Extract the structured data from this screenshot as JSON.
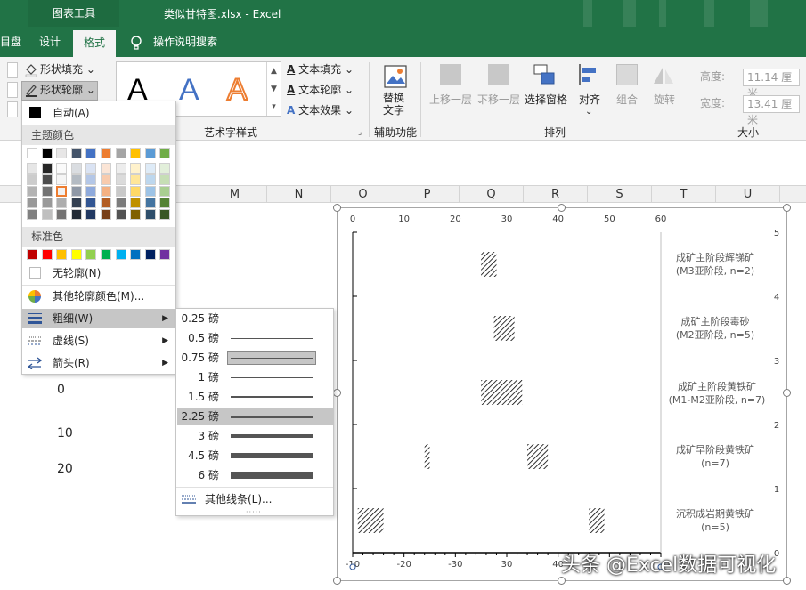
{
  "window": {
    "context_group": "图表工具",
    "title": "类似甘特图.xlsx  -  Excel"
  },
  "tabs": {
    "partial": "目盘",
    "design": "设计",
    "format": "格式",
    "search": "操作说明搜索"
  },
  "ribbon": {
    "shape_fill": "形状填充",
    "shape_outline": "形状轮廓",
    "wordart_label": "艺术字样式",
    "wordart_letter": "A",
    "text_fill": "文本填充",
    "text_outline": "文本轮廓",
    "text_effect": "文本效果",
    "alt_text_line1": "替换",
    "alt_text_line2": "文字",
    "accessibility_label": "辅助功能",
    "bring_forward": "上移一层",
    "send_backward": "下移一层",
    "selection_pane": "选择窗格",
    "align": "对齐",
    "group": "组合",
    "rotate": "旋转",
    "arrange_label": "排列",
    "height_label": "高度:",
    "height_value": "11.14 厘米",
    "width_label": "宽度:",
    "width_value": "13.41 厘米",
    "size_label": "大小"
  },
  "columns": [
    "M",
    "N",
    "O",
    "P",
    "Q",
    "R",
    "S",
    "T",
    "U"
  ],
  "cells": [
    "0",
    "10",
    "20"
  ],
  "outline_menu": {
    "auto": "自动(A)",
    "theme_colors": "主题颜色",
    "standard_colors": "标准色",
    "no_outline": "无轮廓(N)",
    "more_colors": "其他轮廓颜色(M)...",
    "weight": "粗细(W)",
    "dashes": "虚线(S)",
    "arrows": "箭头(R)",
    "theme_top": [
      "#ffffff",
      "#000000",
      "#e7e6e6",
      "#44546a",
      "#4472c4",
      "#ed7d31",
      "#a5a5a5",
      "#ffc000",
      "#5b9bd5",
      "#70ad47"
    ],
    "standard": [
      "#c00000",
      "#ff0000",
      "#ffc000",
      "#ffff00",
      "#92d050",
      "#00b050",
      "#00b0f0",
      "#0070c0",
      "#002060",
      "#7030a0"
    ]
  },
  "weight_menu": {
    "items": [
      "0.25 磅",
      "0.5 磅",
      "0.75 磅",
      "1 磅",
      "1.5 磅",
      "2.25 磅",
      "3 磅",
      "4.5 磅",
      "6 磅"
    ],
    "weights_pt": [
      0.25,
      0.5,
      0.75,
      1,
      1.5,
      2.25,
      3,
      4.5,
      6
    ],
    "selected": "0.75 磅",
    "hovered": "2.25 磅",
    "more_lines": "其他线条(L)..."
  },
  "chart_data": {
    "type": "bar",
    "subtype": "floating-horizontal-bars",
    "x_ticks_top": [
      "0",
      "10",
      "20",
      "30",
      "40",
      "50",
      "60"
    ],
    "x_ticks_bottom": [
      "-10",
      "-20",
      "-30",
      "30",
      "40"
    ],
    "y_ticks_right": [
      "5",
      "4",
      "3",
      "2",
      "1",
      "0"
    ],
    "xlim": [
      0,
      60
    ],
    "ylim": [
      0,
      5
    ],
    "categories": [
      {
        "line1": "成矿主阶段辉锑矿",
        "line2": "(M3亚阶段, n=2)"
      },
      {
        "line1": "成矿主阶段毒砂",
        "line2": "(M2亚阶段, n=5)"
      },
      {
        "line1": "成矿主阶段黄铁矿",
        "line2": "(M1-M2亚阶段, n=7)"
      },
      {
        "line1": "成矿早阶段黄铁矿",
        "line2": "(n=7)"
      },
      {
        "line1": "沉积成岩期黄铁矿",
        "line2": "(n=5)"
      }
    ],
    "ranges": [
      {
        "y": 4.5,
        "start": 25,
        "end": 28
      },
      {
        "y": 3.5,
        "start": 27.5,
        "end": 31.5
      },
      {
        "y": 2.5,
        "start": 25,
        "end": 33
      },
      {
        "y": 1.5,
        "start": 14,
        "end": 15
      },
      {
        "y": 1.5,
        "start": 34,
        "end": 38
      },
      {
        "y": 0.5,
        "start": 1,
        "end": 6
      },
      {
        "y": 0.5,
        "start": 46,
        "end": 49
      }
    ],
    "fill_pattern": "diagonal-hatch",
    "grid": false
  },
  "watermark": "头条 @Excel数据可视化"
}
